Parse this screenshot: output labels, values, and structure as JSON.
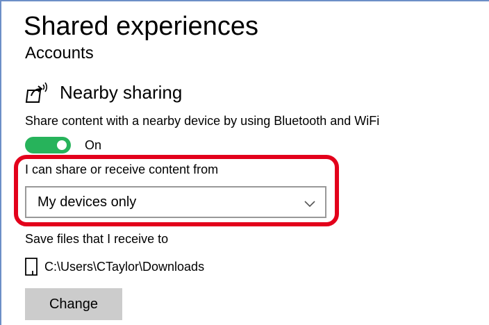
{
  "page": {
    "title": "Shared experiences",
    "subtitle": "Accounts"
  },
  "nearby_sharing": {
    "icon": "share-devices-icon",
    "title": "Nearby sharing",
    "description": "Share content with a nearby device by using Bluetooth and WiFi",
    "toggle": {
      "state": "on",
      "label": "On",
      "color": "#27b35b"
    },
    "receive_from": {
      "label": "I can share or receive content from",
      "selected": "My devices only"
    },
    "save_location": {
      "label": "Save files that I receive to",
      "path": "C:\\Users\\CTaylor\\Downloads",
      "icon": "device-icon"
    },
    "change_button": "Change"
  },
  "colors": {
    "highlight": "#e3001b",
    "frame": "#6d8fc7",
    "button_bg": "#cccccc"
  }
}
